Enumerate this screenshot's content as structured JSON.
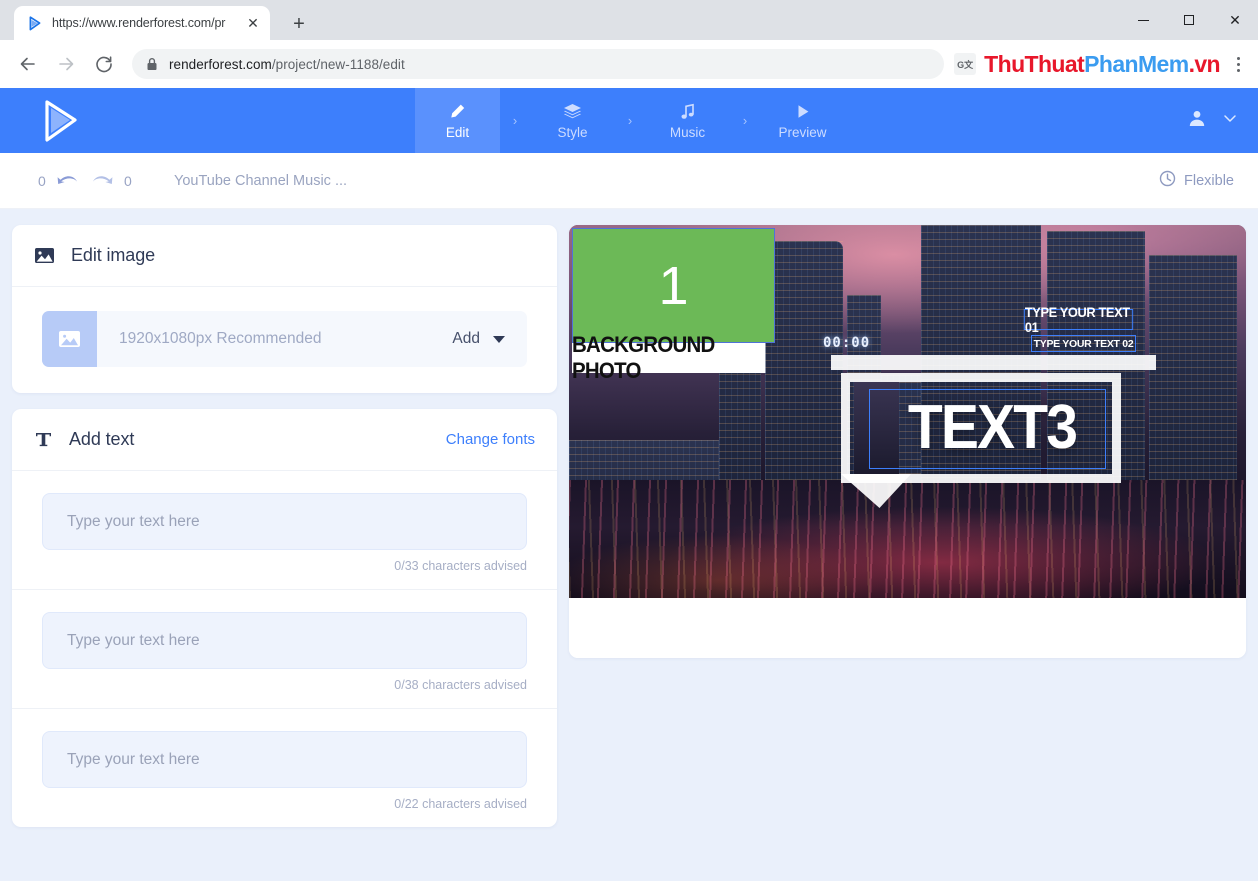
{
  "browser": {
    "tab": {
      "title": "https://www.renderforest.com/pr",
      "favicon": "play-triangle-icon",
      "close_label": "✕"
    },
    "new_tab_label": "+",
    "window_controls": {
      "minimize": "—",
      "maximize": "□",
      "close": "✕"
    },
    "nav": {
      "back": "←",
      "forward": "→",
      "reload": "↻"
    },
    "url": {
      "domain": "renderforest.com",
      "path": "/project/new-1188/edit",
      "lock_icon": "lock-icon"
    },
    "translate_icon_label": "G文",
    "watermark": {
      "part1": "ThuThuat",
      "part2": "PhanMem",
      "part3": ".vn"
    },
    "menu_icon": "kebab-menu-icon"
  },
  "appbar": {
    "brand": "renderforest-play-logo",
    "steps": [
      {
        "label": "Edit",
        "icon": "pencil-icon",
        "active": true
      },
      {
        "label": "Style",
        "icon": "layers-icon",
        "active": false
      },
      {
        "label": "Music",
        "icon": "music-note-icon",
        "active": false
      },
      {
        "label": "Preview",
        "icon": "play-icon",
        "active": false
      }
    ],
    "separator": "›",
    "account_icon": "user-icon",
    "account_caret": "chevron-down-icon"
  },
  "subbar": {
    "undo_count": "0",
    "redo_count": "0",
    "project_title": "YouTube Channel Music ...",
    "duration_mode": "Flexible",
    "duration_icon": "clock-icon"
  },
  "edit_image": {
    "title": "Edit image",
    "icon": "image-icon",
    "media": {
      "thumb_icon": "image-placeholder-icon",
      "recommendation": "1920x1080px Recommended",
      "add_label": "Add",
      "caret_icon": "caret-down-icon"
    }
  },
  "add_text": {
    "title": "Add text",
    "icon": "text-t-icon",
    "change_fonts_label": "Change fonts",
    "fields": [
      {
        "placeholder": "Type your text here",
        "value": "",
        "counter": "0/33 characters advised"
      },
      {
        "placeholder": "Type your text here",
        "value": "",
        "counter": "0/38 characters advised"
      },
      {
        "placeholder": "Type your text here",
        "value": "",
        "counter": "0/22 characters advised"
      }
    ]
  },
  "preview": {
    "placeholder_number": "1",
    "background_photo_label": "BACKGROUND PHOTO",
    "timer": "00:00",
    "overlays": [
      {
        "text": "TYPE YOUR TEXT 01"
      },
      {
        "text": "TYPE YOUR TEXT 02"
      },
      {
        "text": "TEXT3"
      }
    ]
  },
  "colors": {
    "accent": "#3d7ffc",
    "appbar": "#3d7ffc",
    "active_step": "#5a91fd",
    "page_bg": "#eaf0fb",
    "placeholder_green": "#6cb957",
    "watermark_red": "#e8172b",
    "watermark_blue": "#3b9cf0"
  }
}
